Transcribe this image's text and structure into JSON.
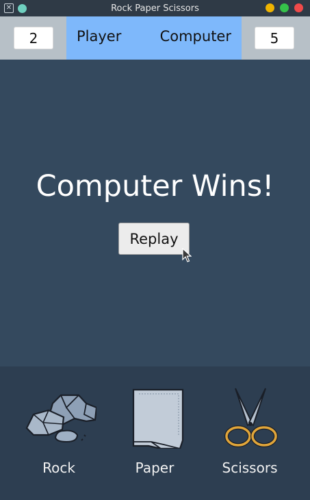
{
  "window": {
    "title": "Rock Paper Scissors",
    "icons": {
      "app": "x-app-icon",
      "pin": "pin-dot-icon",
      "minimize": "minimize-icon",
      "maximize": "maximize-icon",
      "close": "close-icon"
    }
  },
  "scoreboard": {
    "player_score": "2",
    "player_label": "Player",
    "computer_label": "Computer",
    "computer_score": "5"
  },
  "main": {
    "result_text": "Computer Wins!",
    "replay_label": "Replay"
  },
  "choices": [
    {
      "label": "Rock",
      "icon": "rock-icon"
    },
    {
      "label": "Paper",
      "icon": "paper-icon"
    },
    {
      "label": "Scissors",
      "icon": "scissors-icon"
    }
  ],
  "colors": {
    "titlebar": "#2f3a46",
    "scorebar": "#b7c0c7",
    "names_highlight": "#7eb8fb",
    "main_bg": "#34495e",
    "choices_bg": "#2d3e51"
  }
}
